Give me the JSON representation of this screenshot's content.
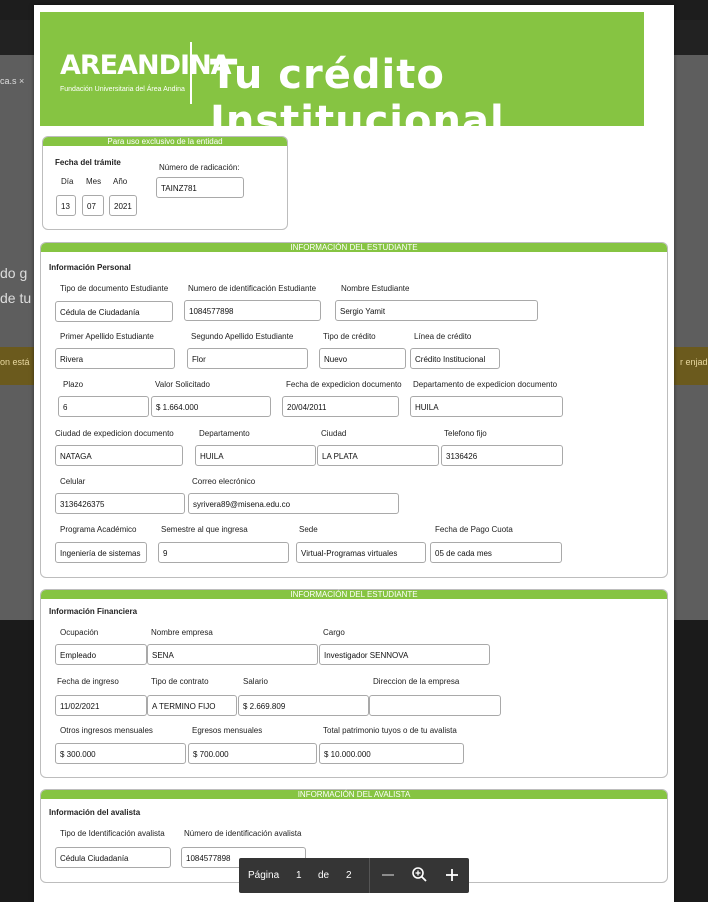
{
  "background": {
    "chip_label": "ca.s ×",
    "text_line1": "do g",
    "text_line2": "de tu",
    "left_note": "on está",
    "right_note": "r enjad"
  },
  "banner": {
    "logo": "AREANDINA",
    "logo_subtitle": "Fundación Universitaria del Área Andina",
    "title": "Tu crédito Institucional"
  },
  "entidad": {
    "header": "Para uso exclusivo de la entidad",
    "fecha_label": "Fecha del trámite",
    "dia_label": "Día",
    "mes_label": "Mes",
    "anio_label": "Año",
    "dia": "13",
    "mes": "07",
    "anio": "2021",
    "radicacion_label": "Número de radicación:",
    "radicacion": "TAINZ781"
  },
  "estudiante": {
    "header": "INFORMACIÓN DEL ESTUDIANTE",
    "section": "Información Personal",
    "tipo_doc_label": "Tipo de documento Estudiante",
    "tipo_doc": "Cédula de Ciudadanía",
    "num_id_label": "Numero de identificación Estudiante",
    "num_id": "1084577898",
    "nombre_label": "Nombre Estudiante",
    "nombre": "Sergio Yamit",
    "apellido1_label": "Primer Apellido Estudiante",
    "apellido1": "Rivera",
    "apellido2_label": "Segundo Apellido Estudiante",
    "apellido2": "Flor",
    "tipo_credito_label": "Tipo de crédito",
    "tipo_credito": "Nuevo",
    "linea_label": "Línea de crédito",
    "linea": "Crédito Institucional",
    "plazo_label": "Plazo",
    "plazo": "6",
    "valor_label": "Valor Solicitado",
    "valor": "$ 1.664.000",
    "fecha_exp_label": "Fecha de expedicion documento",
    "fecha_exp": "20/04/2011",
    "depto_exp_label": "Departamento de expedicion documento",
    "depto_exp": "HUILA",
    "ciudad_exp_label": "Ciudad de expedicion documento",
    "ciudad_exp": "NATAGA",
    "depto_label": "Departamento",
    "depto": "HUILA",
    "ciudad_label": "Ciudad",
    "ciudad": "LA PLATA",
    "tel_label": "Telefono fijo",
    "tel": "3136426",
    "celular_label": "Celular",
    "celular": "3136426375",
    "correo_label": "Correo elecrónico",
    "correo": "syrivera89@misena.edu.co",
    "programa_label": "Programa Académico",
    "programa": "Ingeniería de sistemas",
    "semestre_label": "Semestre al que ingresa",
    "semestre": "9",
    "sede_label": "Sede",
    "sede": "Virtual-Programas virtuales",
    "pago_label": "Fecha de Pago Cuota",
    "pago": "05 de cada mes"
  },
  "financiera": {
    "header": "INFORMACIÓN DEL ESTUDIANTE",
    "section": "Información Financiera",
    "ocupacion_label": "Ocupación",
    "ocupacion": "Empleado",
    "empresa_label": "Nombre empresa",
    "empresa": "SENA",
    "cargo_label": "Cargo",
    "cargo": "Investigador SENNOVA",
    "fecha_ingreso_label": "Fecha de ingreso",
    "fecha_ingreso": "11/02/2021",
    "contrato_label": "Tipo de contrato",
    "contrato": "A TERMINO FIJO",
    "salario_label": "Salario",
    "salario": "$ 2.669.809",
    "direccion_label": "Direccion de la empresa",
    "direccion": "",
    "otros_label": "Otros ingresos mensuales",
    "otros": "$ 300.000",
    "egresos_label": "Egresos mensuales",
    "egresos": "$ 700.000",
    "patrimonio_label": "Total patrimonio tuyos o de tu avalista",
    "patrimonio": "$ 10.000.000"
  },
  "avalista": {
    "header": "INFORMACIÓN DEL AVALISTA",
    "section": "Información del avalista",
    "tipo_label": "Tipo de Identificación avalista",
    "tipo": "Cédula Ciudadanía",
    "num_label": "Número de identificación avalista",
    "num": "1084577898"
  },
  "toolbar": {
    "pagina_label": "Página",
    "current_page": "1",
    "de_label": "de",
    "total_pages": "2",
    "zoom_out_icon": "minus-icon",
    "zoom_icon": "magnifier-plus-icon",
    "zoom_in_icon": "plus-icon"
  }
}
